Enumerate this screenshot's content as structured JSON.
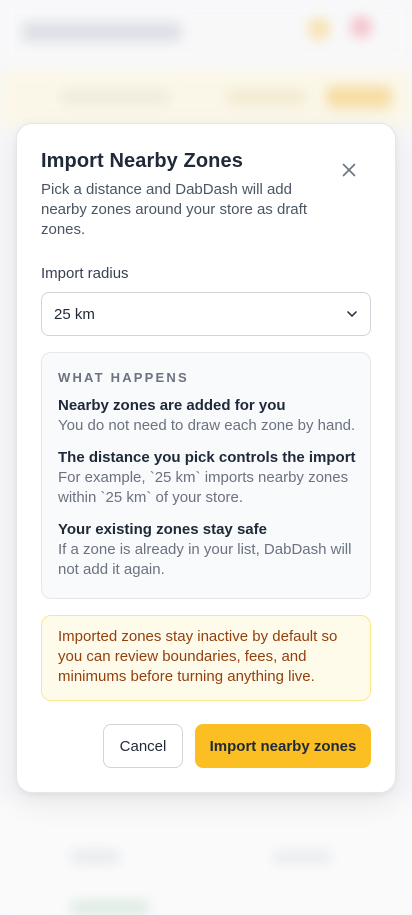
{
  "modal": {
    "title": "Import Nearby Zones",
    "subtitle": "Pick a distance and DabDash will add nearby zones around your store as draft zones.",
    "close_icon": "close-icon",
    "radius": {
      "label": "Import radius",
      "value": "25 km",
      "chevron_icon": "chevron-down-icon"
    },
    "info": {
      "heading": "WHAT HAPPENS",
      "items": [
        {
          "title": "Nearby zones are added for you",
          "desc": "You do not need to draw each zone by hand."
        },
        {
          "title": "The distance you pick controls the import",
          "desc": "For example, `25 km` imports nearby zones within `25 km` of your store."
        },
        {
          "title": "Your existing zones stay safe",
          "desc": "If a zone is already in your list, DabDash will not add it again."
        }
      ]
    },
    "notice": "Imported zones stay inactive by default so you can review boundaries, fees, and minimums before turning anything live.",
    "actions": {
      "cancel_label": "Cancel",
      "import_label": "Import nearby zones"
    }
  },
  "colors": {
    "accent": "#fbbf24",
    "notice_bg": "#fffbeb",
    "notice_text": "#92400e"
  }
}
